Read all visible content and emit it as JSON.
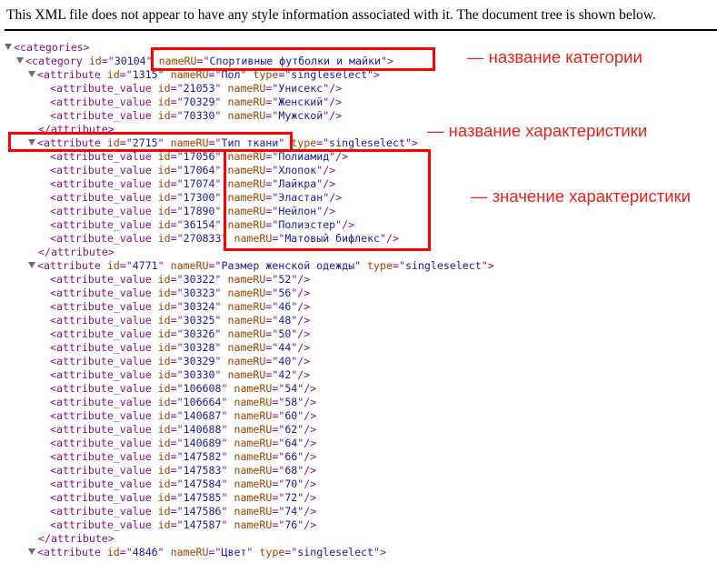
{
  "header_text": "This XML file does not appear to have any style information associated with it. The document tree is shown below.",
  "annotations": {
    "category_name": "— название категории",
    "attribute_name": "— название характеристики",
    "attribute_value": "— значение характеристики"
  },
  "annotation_color": "#e8231e",
  "syntax_colors": {
    "tag": "#881280",
    "attr_name": "#994500",
    "attr_value": "#1a1aa6"
  },
  "tree": {
    "root_open": "<categories>",
    "category": {
      "id": "30104",
      "nameRU": "Спортивные футболки и майки"
    },
    "attributes": [
      {
        "id": "1315",
        "nameRU": "Пол",
        "type": "singleselect",
        "closed": true,
        "values": [
          {
            "id": "21053",
            "nameRU": "Унисекс"
          },
          {
            "id": "70329",
            "nameRU": "Женский"
          },
          {
            "id": "70330",
            "nameRU": "Мужской"
          }
        ]
      },
      {
        "id": "2715",
        "nameRU": "Тип ткани",
        "type": "singleselect",
        "closed": true,
        "values": [
          {
            "id": "17056",
            "nameRU": "Полиамид"
          },
          {
            "id": "17064",
            "nameRU": "Хлопок"
          },
          {
            "id": "17074",
            "nameRU": "Лайкра"
          },
          {
            "id": "17300",
            "nameRU": "Эластан"
          },
          {
            "id": "17890",
            "nameRU": "Нейлон"
          },
          {
            "id": "36154",
            "nameRU": "Полиэстер"
          },
          {
            "id": "270833",
            "nameRU": "Матовый бифлекс"
          }
        ]
      },
      {
        "id": "4771",
        "nameRU": "Размер женской одежды",
        "type": "singleselect",
        "closed": true,
        "values": [
          {
            "id": "30322",
            "nameRU": "52"
          },
          {
            "id": "30323",
            "nameRU": "56"
          },
          {
            "id": "30324",
            "nameRU": "46"
          },
          {
            "id": "30325",
            "nameRU": "48"
          },
          {
            "id": "30326",
            "nameRU": "50"
          },
          {
            "id": "30328",
            "nameRU": "44"
          },
          {
            "id": "30329",
            "nameRU": "40"
          },
          {
            "id": "30330",
            "nameRU": "42"
          },
          {
            "id": "106608",
            "nameRU": "54"
          },
          {
            "id": "106664",
            "nameRU": "58"
          },
          {
            "id": "140687",
            "nameRU": "60"
          },
          {
            "id": "140688",
            "nameRU": "62"
          },
          {
            "id": "140689",
            "nameRU": "64"
          },
          {
            "id": "147582",
            "nameRU": "66"
          },
          {
            "id": "147583",
            "nameRU": "68"
          },
          {
            "id": "147584",
            "nameRU": "70"
          },
          {
            "id": "147585",
            "nameRU": "72"
          },
          {
            "id": "147586",
            "nameRU": "74"
          },
          {
            "id": "147587",
            "nameRU": "76"
          }
        ]
      },
      {
        "id": "4846",
        "nameRU": "Цвет",
        "type": "singleselect",
        "closed": false,
        "values": []
      }
    ]
  }
}
